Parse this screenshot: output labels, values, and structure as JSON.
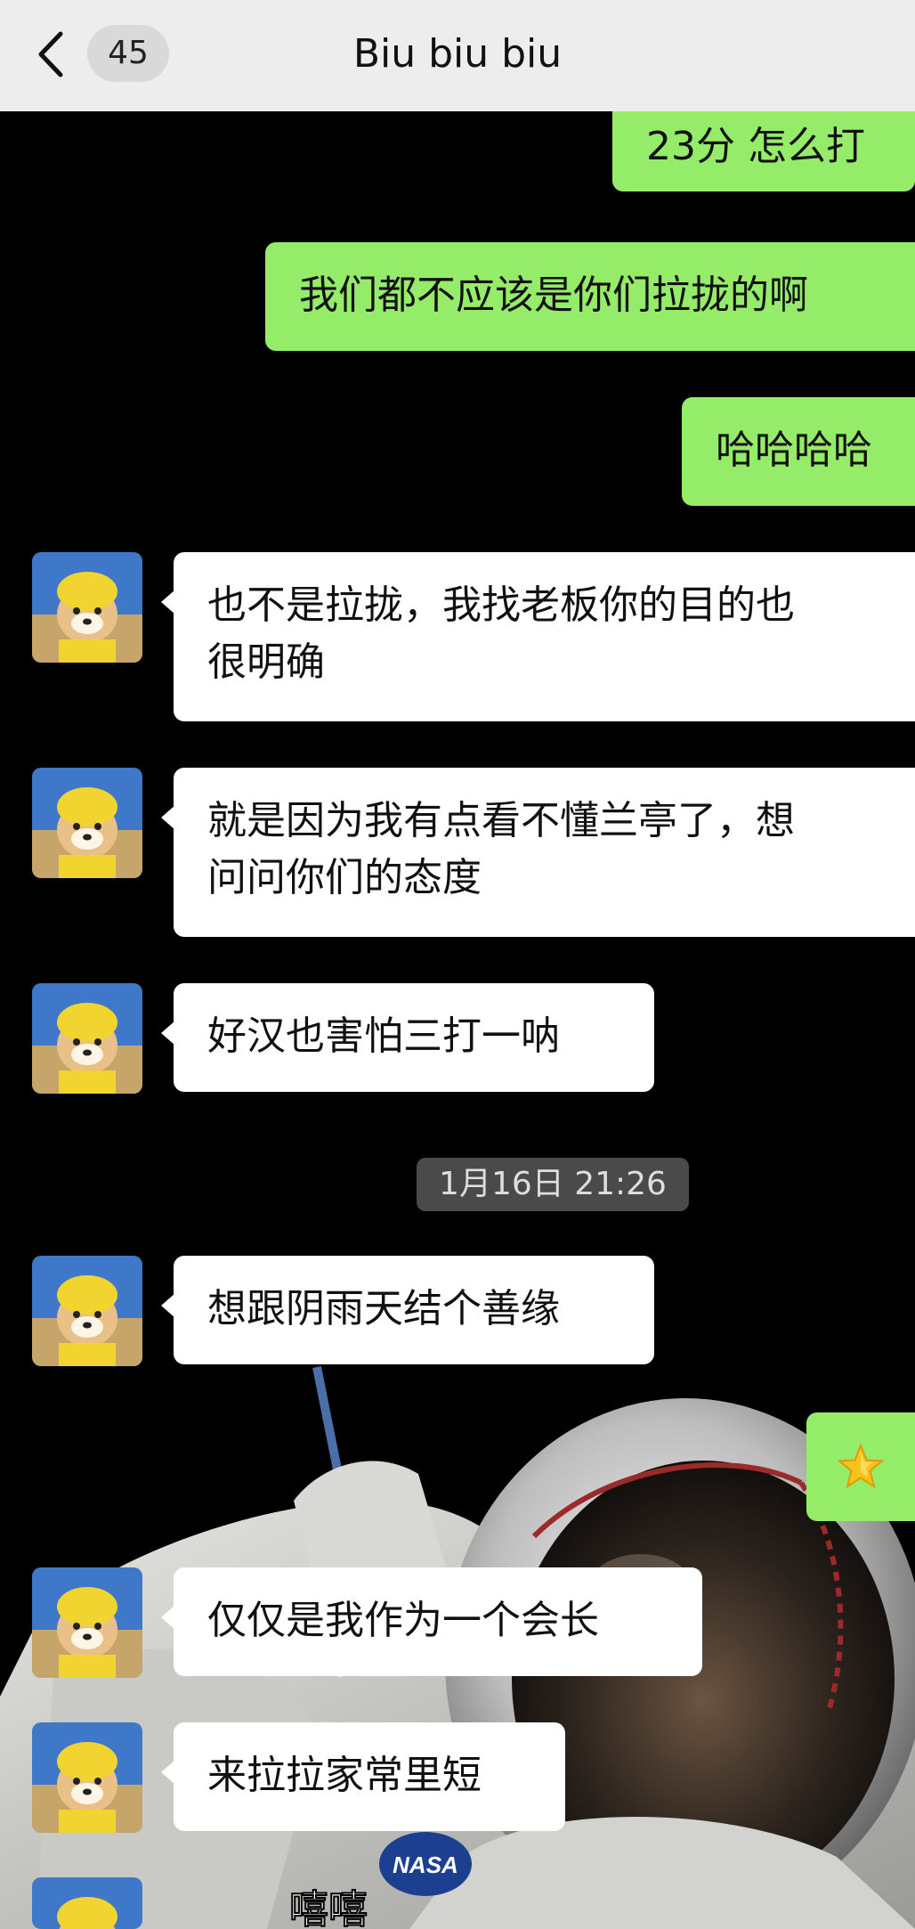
{
  "header": {
    "back_icon": "chevron-left-icon",
    "unread_count": "45",
    "title": "Biu biu biu"
  },
  "messages": [
    {
      "side": "out",
      "text": "23分 怎么打"
    },
    {
      "side": "out",
      "text": "我们都不应该是你们拉拢的啊"
    },
    {
      "side": "out",
      "text": "哈哈哈哈"
    },
    {
      "side": "in",
      "lines": [
        "也不是拉拢，我找老板你的目的也",
        "很明确"
      ]
    },
    {
      "side": "in",
      "lines": [
        "就是因为我有点看不懂兰亭了，想",
        "问问你们的态度"
      ]
    },
    {
      "side": "in",
      "text": "好汉也害怕三打一呐"
    },
    {
      "side": "in",
      "text": "想跟阴雨天结个善缘"
    },
    {
      "side": "out",
      "icon": "star-emoji-icon"
    },
    {
      "side": "in",
      "text": "仅仅是我作为一个会长"
    },
    {
      "side": "in",
      "text": "来拉拉家常里短"
    }
  ],
  "timestamp": "1月16日 21:26",
  "background": {
    "description_icon": "astronaut-wallpaper",
    "patch_text": "NASA",
    "caption_text": "嘻嘻"
  },
  "colors": {
    "header_bg": "#ededed",
    "outgoing_bubble": "#95ec69",
    "incoming_bubble": "#ffffff",
    "chat_bg": "#000000"
  }
}
